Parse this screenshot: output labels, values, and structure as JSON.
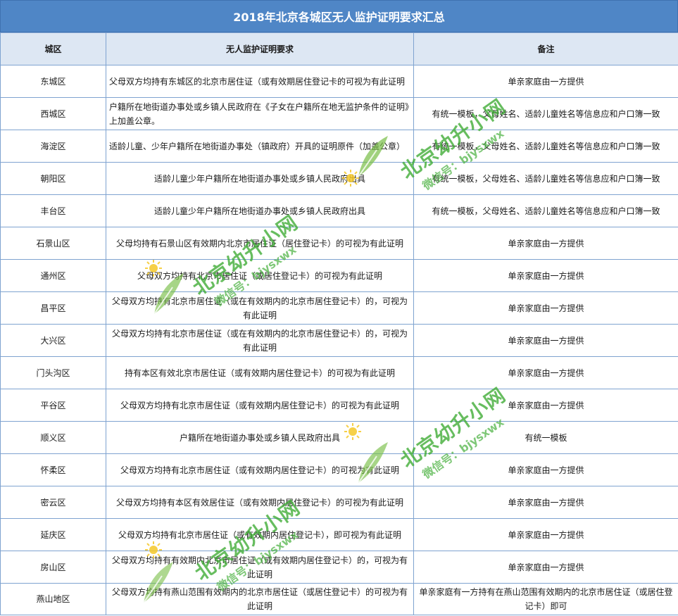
{
  "title": "2018年北京各城区无人监护证明要求汇总",
  "headers": {
    "district": "城区",
    "requirement": "无人监护证明要求",
    "note": "备注"
  },
  "rows": [
    {
      "district": "东城区",
      "requirement": "父母双方均持有东城区的北京市居住证（或有效期居住登记卡的可视为有此证明",
      "note": "单亲家庭由一方提供"
    },
    {
      "district": "西城区",
      "requirement": "户籍所在地街道办事处或乡镇人民政府在《子女在户籍所在地无监护条件的证明》上加盖公章。",
      "note": "有统一模板，父母姓名、适龄儿童姓名等信息应和户口簿一致"
    },
    {
      "district": "海淀区",
      "requirement": "适龄儿童、少年户籍所在地街道办事处（镇政府）开具的证明原件（加盖公章）",
      "note": "有统一模板，父母姓名、适龄儿童姓名等信息应和户口簿一致"
    },
    {
      "district": "朝阳区",
      "requirement": "适龄儿童少年户籍所在地街道办事处或乡镇人民政府出具",
      "note": "有统一模板，父母姓名、适龄儿童姓名等信息应和户口簿一致"
    },
    {
      "district": "丰台区",
      "requirement": "适龄儿童少年户籍所在地街道办事处或乡镇人民政府出具",
      "note": "有统一模板，父母姓名、适龄儿童姓名等信息应和户口簿一致"
    },
    {
      "district": "石景山区",
      "requirement": "父母均持有石景山区有效期内北京市居住证（居住登记卡）的可视为有此证明",
      "note": "单亲家庭由一方提供"
    },
    {
      "district": "通州区",
      "requirement": "父母双方均持有北京市居住证（或居住登记卡）的可视为有此证明",
      "note": "单亲家庭由一方提供"
    },
    {
      "district": "昌平区",
      "requirement": "父母双方均持有北京市居住证（或在有效期内的北京市居住登记卡）的，可视为有此证明",
      "note": "单亲家庭由一方提供"
    },
    {
      "district": "大兴区",
      "requirement": "父母双方均持有北京市居住证（或在有效期内的北京市居住登记卡）的，可视为有此证明",
      "note": "单亲家庭由一方提供"
    },
    {
      "district": "门头沟区",
      "requirement": "持有本区有效北京市居住证（或有效期内居住登记卡）的可视为有此证明",
      "note": "单亲家庭由一方提供"
    },
    {
      "district": "平谷区",
      "requirement": "父母双方均持有北京市居住证（或有效期内居住登记卡）的可视为有此证明",
      "note": "单亲家庭由一方提供"
    },
    {
      "district": "顺义区",
      "requirement": "户籍所在地街道办事处或乡镇人民政府出具",
      "note": "有统一模板"
    },
    {
      "district": "怀柔区",
      "requirement": "父母双方均持有北京市居住证（或有效期内居住登记卡）的可视为有此证明",
      "note": "单亲家庭由一方提供"
    },
    {
      "district": "密云区",
      "requirement": "父母双方均持有本区有效居住证（或有效期内居住登记卡）的可视为有此证明",
      "note": "单亲家庭由一方提供"
    },
    {
      "district": "延庆区",
      "requirement": "父母双方均持有北京市居住证（或有效期内居住登记卡），即可视为有此证明",
      "note": "单亲家庭由一方提供"
    },
    {
      "district": "房山区",
      "requirement": "父母双方均持有有效期内北京市居住证（或有效期内居住登记卡）的，可视为有此证明",
      "note": "单亲家庭由一方提供"
    },
    {
      "district": "燕山地区",
      "requirement": "父母双方均持有燕山范围有效期内的北京市居住证（或居住登记卡）的可视为有此证明",
      "note": "单亲家庭有一方持有在燕山范围有效期内的北京市居住证（或居住登记卡）即可"
    }
  ],
  "watermark": {
    "main": "北京幼升小网",
    "sub": "微信号：bjysxwx"
  },
  "colors": {
    "title_bg": "#4f86c6",
    "header_bg": "#dde7f3",
    "border": "#7fa3d0",
    "watermark": "#3caa32"
  }
}
